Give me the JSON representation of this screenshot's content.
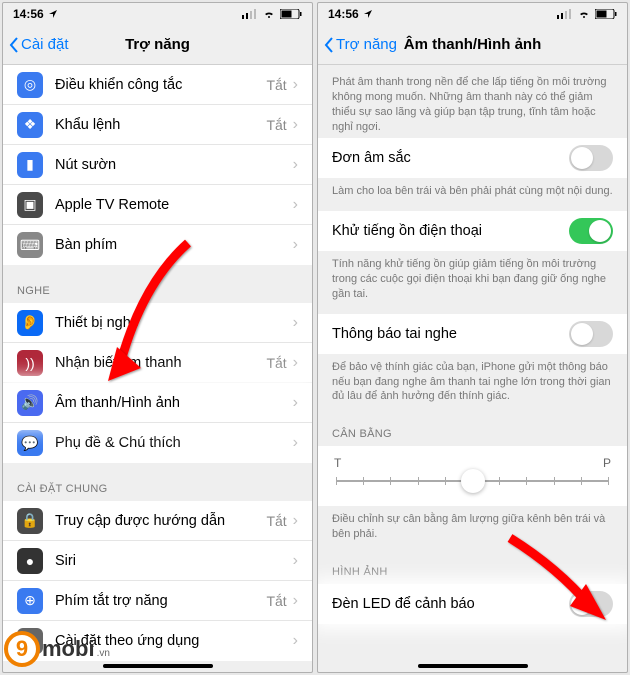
{
  "statusbar": {
    "time": "14:56"
  },
  "left": {
    "back": "Cài đặt",
    "title": "Trợ năng",
    "section_top": [
      {
        "label": "Điều khiển công tắc",
        "detail": "Tắt",
        "icon": "ic-slider"
      },
      {
        "label": "Khẩu lệnh",
        "detail": "Tắt",
        "icon": "ic-key"
      },
      {
        "label": "Nút sườn",
        "detail": "",
        "icon": "ic-side"
      },
      {
        "label": "Apple TV Remote",
        "detail": "",
        "icon": "ic-tv"
      },
      {
        "label": "Bàn phím",
        "detail": "",
        "icon": "ic-kb"
      }
    ],
    "section_nghe_header": "NGHE",
    "section_nghe": [
      {
        "label": "Thiết bị nghe",
        "detail": "",
        "icon": "ic-ear"
      },
      {
        "label": "Nhận biết âm thanh",
        "detail": "Tắt",
        "icon": "ic-music"
      },
      {
        "label": "Âm thanh/Hình ảnh",
        "detail": "",
        "icon": "ic-audio",
        "highlight": true
      },
      {
        "label": "Phụ đề & Chú thích",
        "detail": "",
        "icon": "ic-subtitle"
      }
    ],
    "section_chung_header": "CÀI ĐẶT CHUNG",
    "section_chung": [
      {
        "label": "Truy cập được hướng dẫn",
        "detail": "Tắt",
        "icon": "ic-guided"
      },
      {
        "label": "Siri",
        "detail": "",
        "icon": "ic-siri"
      },
      {
        "label": "Phím tắt trợ năng",
        "detail": "Tắt",
        "icon": "ic-shortcut"
      },
      {
        "label": "Cài đặt theo ứng dụng",
        "detail": "",
        "icon": "ic-perapp"
      }
    ]
  },
  "right": {
    "back": "Trợ năng",
    "title": "Âm thanh/Hình ảnh",
    "intro": "Phát âm thanh trong nền để che lấp tiếng ồn môi trường không mong muốn. Những âm thanh này có thể giảm thiểu sự sao lãng và giúp bạn tập trung, tĩnh tâm hoặc nghỉ ngơi.",
    "mono": {
      "label": "Đơn âm sắc",
      "on": false
    },
    "mono_footer": "Làm cho loa bên trái và bên phải phát cùng một nội dung.",
    "noise": {
      "label": "Khử tiếng ồn điện thoại",
      "on": true
    },
    "noise_footer": "Tính năng khử tiếng ồn giúp giảm tiếng ồn môi trường trong các cuộc gọi điện thoại khi bạn đang giữ ống nghe gần tai.",
    "headphone": {
      "label": "Thông báo tai nghe",
      "on": false
    },
    "headphone_footer": "Để bảo vệ thính giác của bạn, iPhone gửi một thông báo nếu bạn đang nghe âm thanh tai nghe lớn trong thời gian đủ lâu để ảnh hưởng đến thính giác.",
    "balance_header": "CÂN BẰNG",
    "balance": {
      "left": "T",
      "right": "P"
    },
    "balance_footer": "Điều chỉnh sự cân bằng âm lượng giữa kênh bên trái và bên phải.",
    "hinhanh_header": "HÌNH ẢNH",
    "led": {
      "label": "Đèn LED để cảnh báo",
      "on": false,
      "highlight": true
    }
  },
  "logo": {
    "nine": "9",
    "brand": "mobi",
    "suffix": ".vn"
  }
}
